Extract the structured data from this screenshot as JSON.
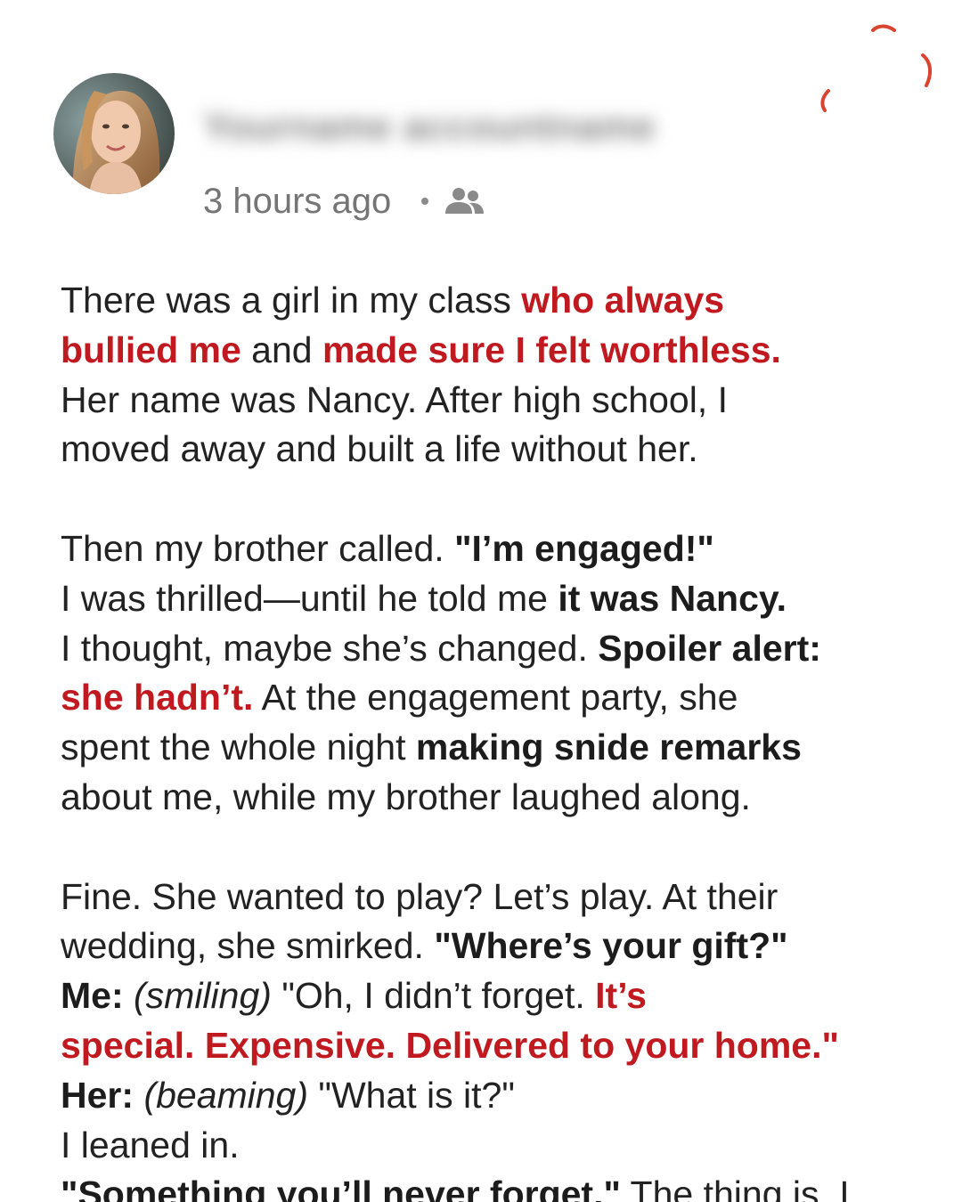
{
  "post": {
    "username": "Yourname accountname",
    "timestamp": "3 hours ago",
    "audience_icon": "friends-icon",
    "accent_color": "#c0191f"
  },
  "body": {
    "p1": {
      "l1a": "There was a girl in my class ",
      "l1b": "who always",
      "l2a": "bullied me",
      "l2b": " and ",
      "l2c": "made sure I felt worthless.",
      "l3": "Her name was Nancy. After high school, I",
      "l4": "moved away and built a life without her."
    },
    "p2": {
      "l1a": "Then my brother called. ",
      "l1b": "\"I’m engaged!\"",
      "l2a": "I was thrilled—until he told me ",
      "l2b": "it was Nancy.",
      "l3a": "I thought, maybe she’s changed. ",
      "l3b": "Spoiler alert:",
      "l4a": "she hadn’t.",
      "l4b": " At the engagement party, she",
      "l5a": "spent the whole night ",
      "l5b": "making snide remarks",
      "l6": "about me, while my brother laughed along."
    },
    "p3": {
      "l1": "Fine. She wanted to play? Let’s play. At their",
      "l2a": "wedding, she smirked. ",
      "l2b": "\"Where’s your gift?\"",
      "l3a": "Me:",
      "l3b": " ",
      "l3c": "(smiling)",
      "l3d": " \"Oh, I didn’t forget. ",
      "l3e": "It’s",
      "l4": "special. Expensive. Delivered to your home.\"",
      "l5a": "Her:",
      "l5b": " ",
      "l5c": "(beaming)",
      "l5d": " \"What is it?\"",
      "l6": "I leaned in.",
      "l7a": "\"Something you’ll never forget.\"",
      "l7b": " The thing is, I"
    }
  }
}
